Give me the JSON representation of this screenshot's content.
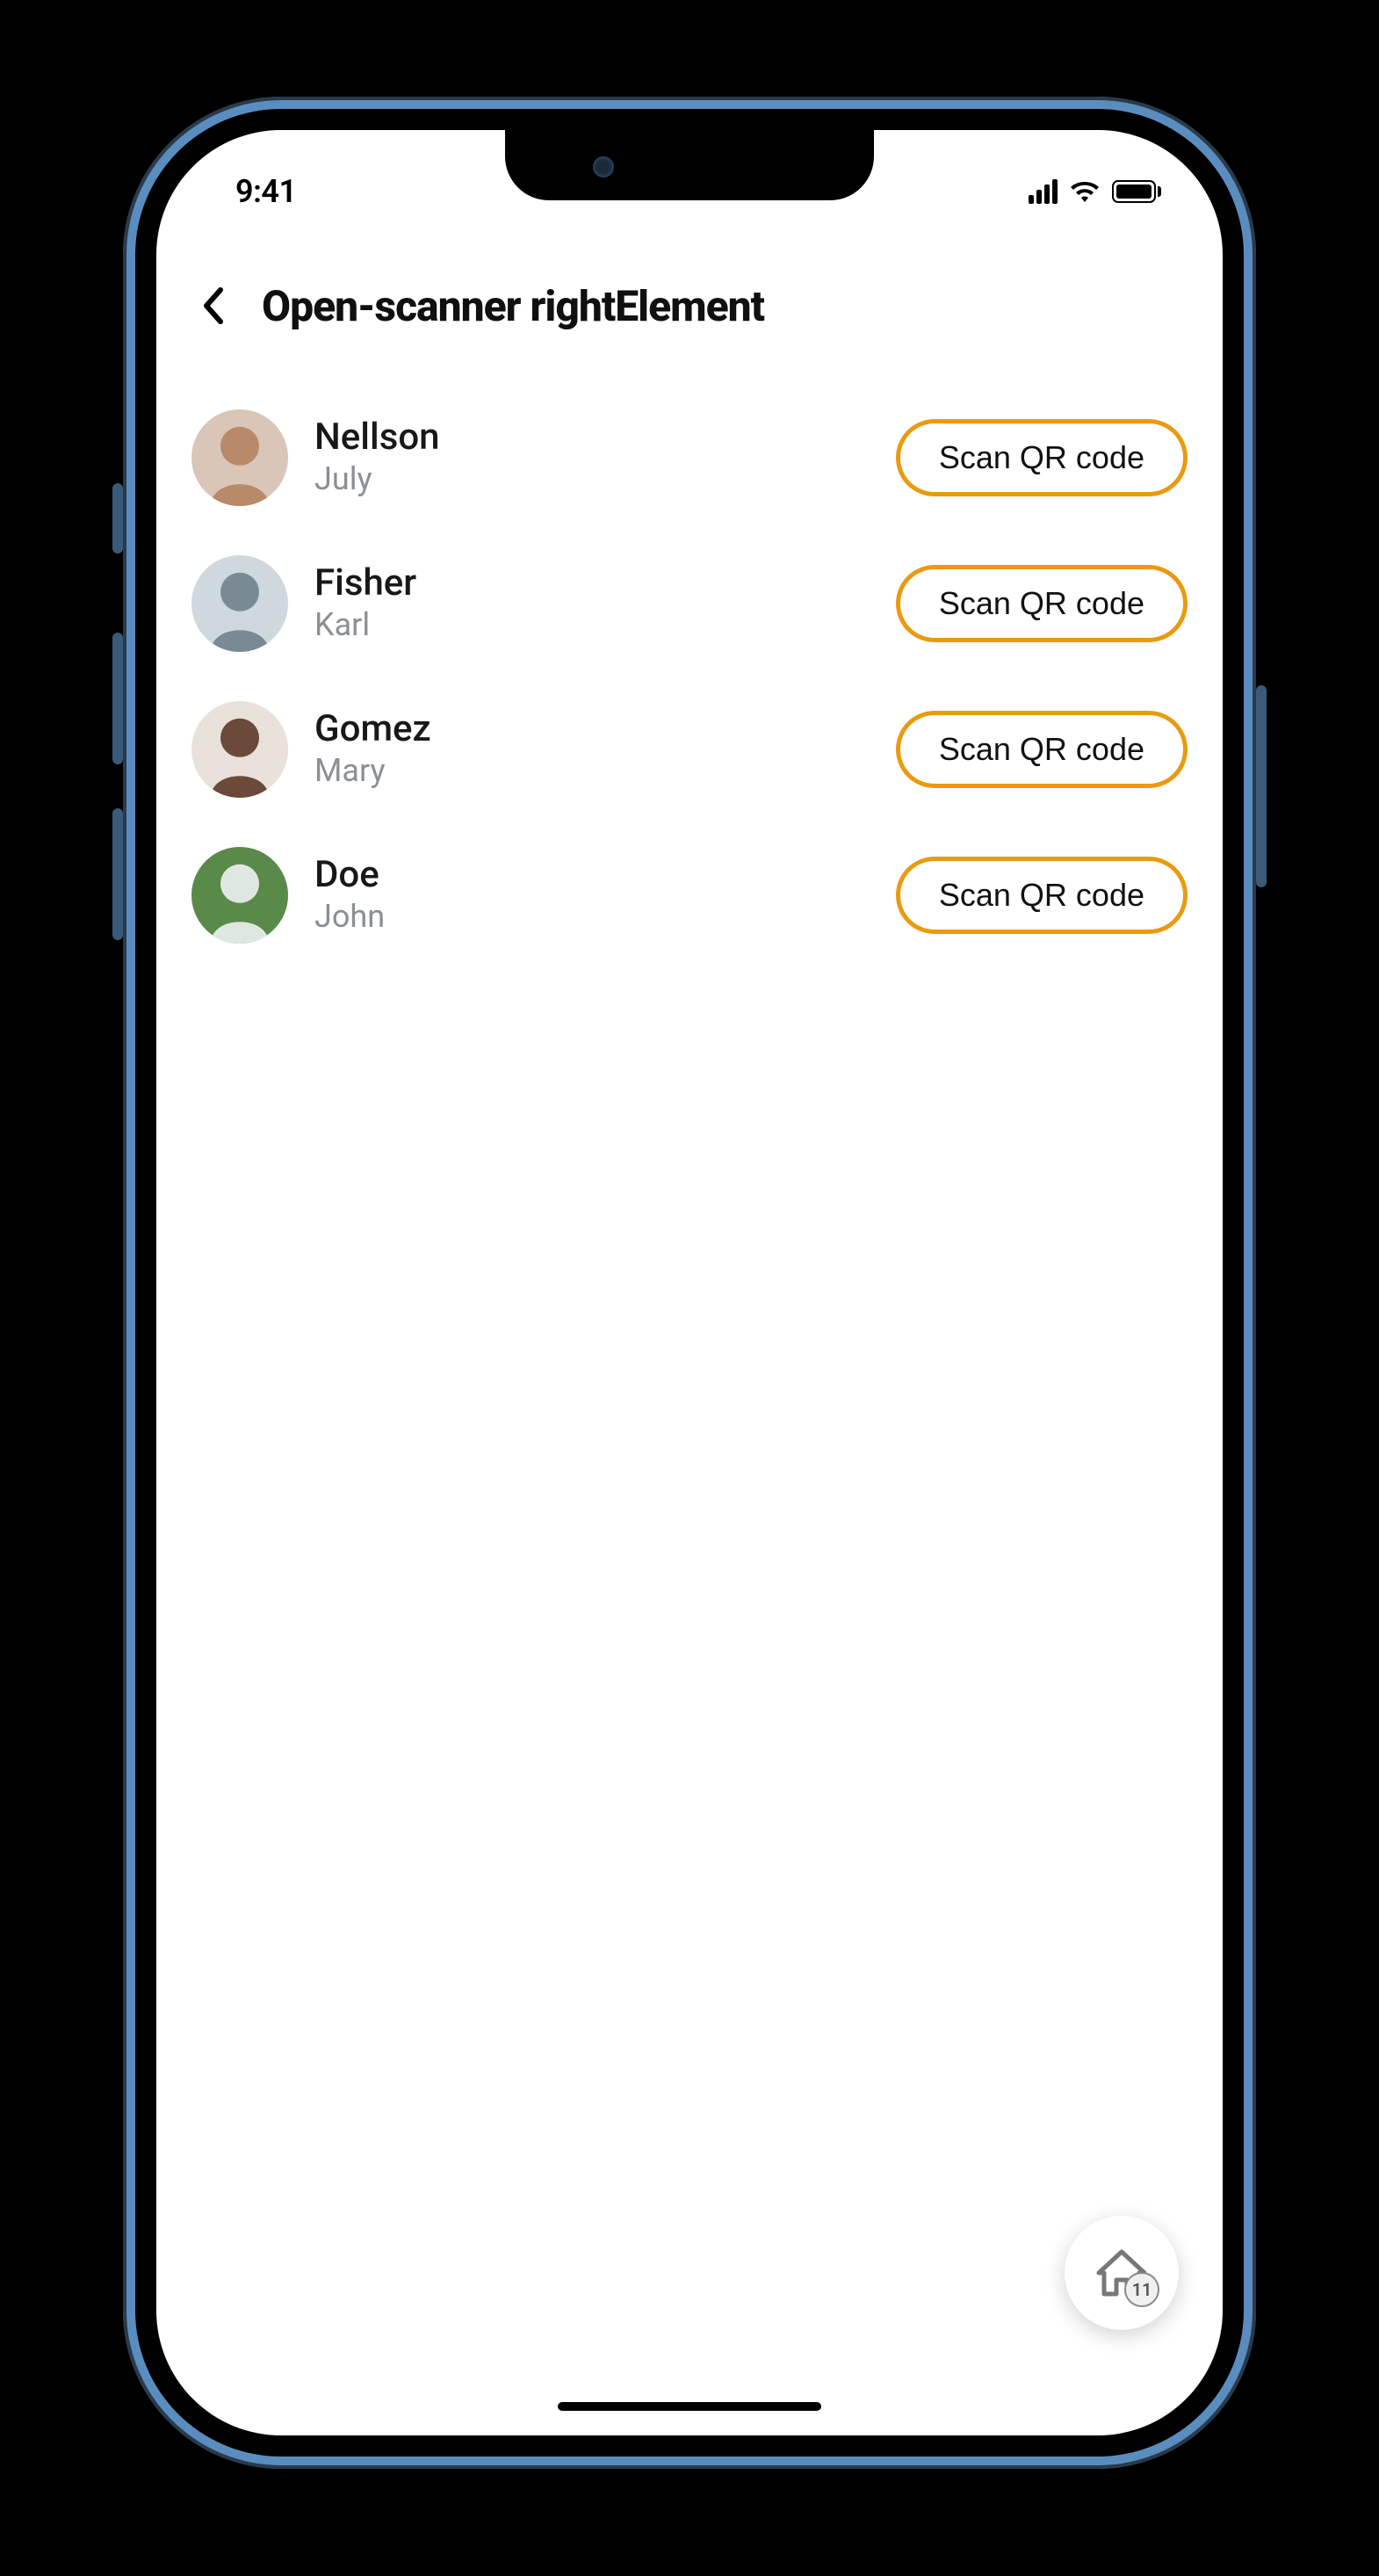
{
  "status_bar": {
    "time": "9:41"
  },
  "header": {
    "title": "Open-scanner rightElement"
  },
  "scan_button_label": "Scan QR code",
  "people": [
    {
      "surname": "Nellson",
      "firstname": "July",
      "avatar_bg": "#d9c6b8",
      "avatar_fg": "#b88a6a"
    },
    {
      "surname": "Fisher",
      "firstname": "Karl",
      "avatar_bg": "#cfd8dc",
      "avatar_fg": "#7a8a94"
    },
    {
      "surname": "Gomez",
      "firstname": "Mary",
      "avatar_bg": "#e8e2da",
      "avatar_fg": "#6b4a3a"
    },
    {
      "surname": "Doe",
      "firstname": "John",
      "avatar_bg": "#5a8a4a",
      "avatar_fg": "#dfe8e0"
    }
  ],
  "home_fab": {
    "badge_count": "11"
  }
}
